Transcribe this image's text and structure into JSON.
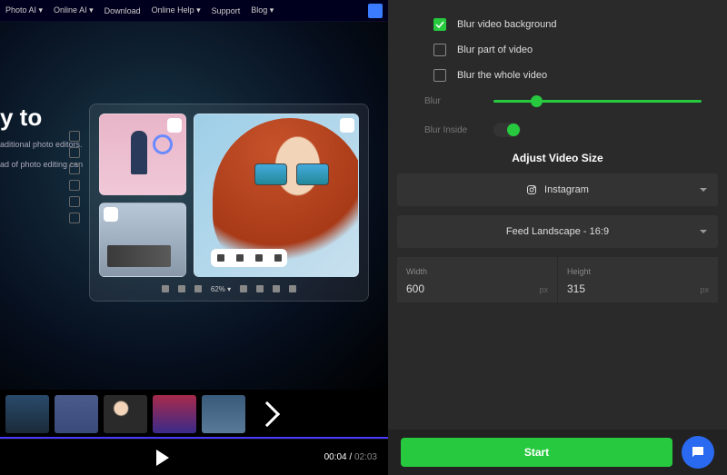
{
  "nav": {
    "items": [
      "Photo AI ▾",
      "Online AI ▾",
      "Download",
      "Online Help ▾",
      "Support",
      "Blog ▾"
    ]
  },
  "hero": {
    "title_part": "y to",
    "para1": "aditional photo editors.",
    "para2": "ad of photo editing can"
  },
  "frame": {
    "zoom": "62% ▾"
  },
  "player": {
    "current": "00:04",
    "duration": "02:03"
  },
  "options": {
    "bg": "Blur video background",
    "part": "Blur part of video",
    "whole": "Blur the whole video"
  },
  "sliders": {
    "blur_label": "Blur",
    "blur_pos_pct": 18,
    "inside_label": "Blur Inside",
    "inside_on": true
  },
  "size": {
    "title": "Adjust Video Size",
    "platform": "Instagram",
    "aspect": "Feed Landscape - 16:9",
    "width_label": "Width",
    "width_value": "600",
    "width_unit": "px",
    "height_label": "Height",
    "height_value": "315",
    "height_unit": "px"
  },
  "footer": {
    "start": "Start"
  }
}
